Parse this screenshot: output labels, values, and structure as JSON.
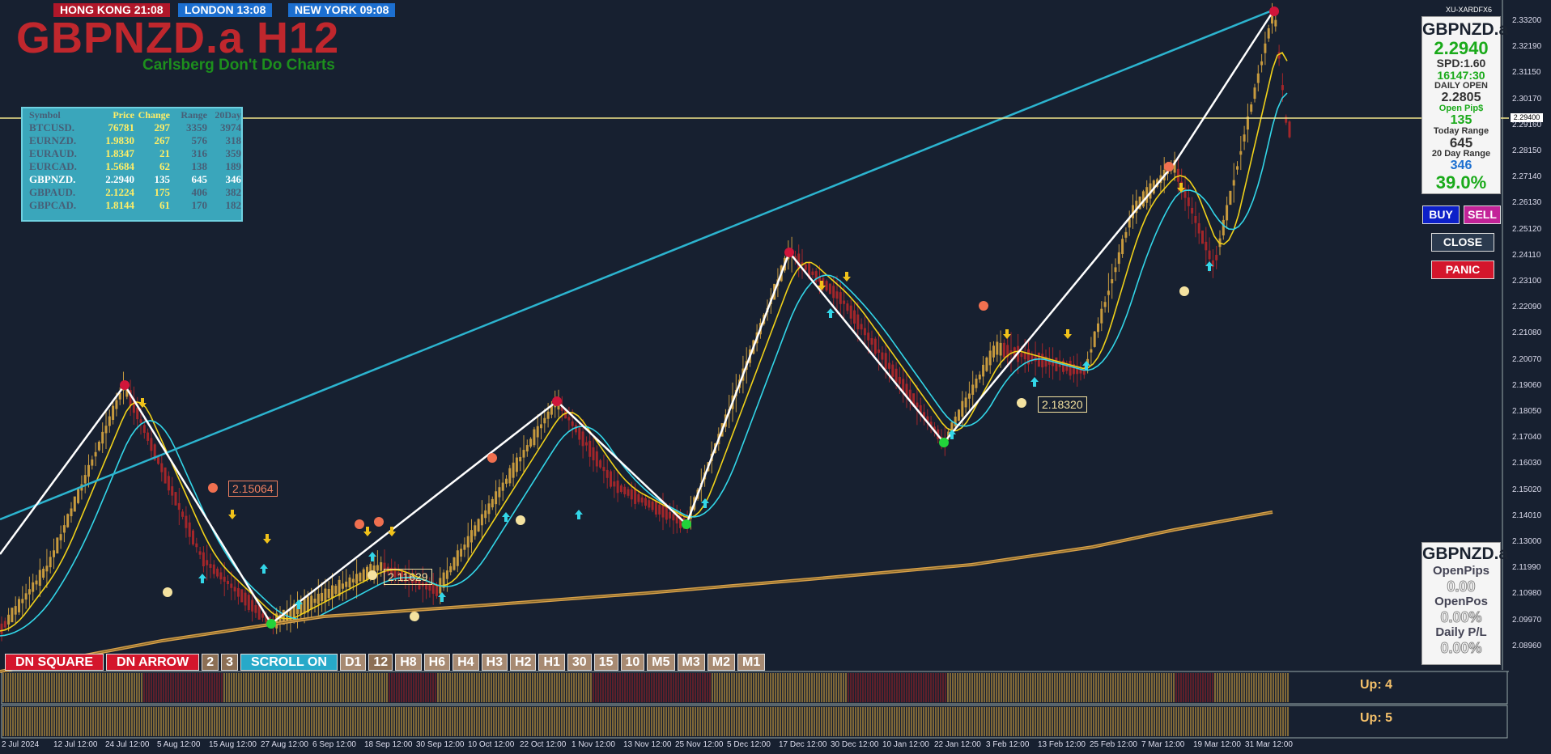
{
  "clocks": {
    "hong_kong": "HONG KONG 21:08",
    "london": "LONDON  13:08",
    "new_york": "NEW YORK  09:08"
  },
  "title": "GBPNZD.a H12",
  "subtitle": "Carlsberg Don't Do Charts",
  "broker": "XU-XARDFX6",
  "market_watch": {
    "headers": [
      "Symbol",
      "Price",
      "Change",
      "Range",
      "20Day"
    ],
    "rows": [
      {
        "symbol": "BTCUSD.",
        "price": "76781",
        "change": "297",
        "range": "3359",
        "d20": "3974"
      },
      {
        "symbol": "EURNZD.",
        "price": "1.9830",
        "change": "267",
        "range": "576",
        "d20": "318"
      },
      {
        "symbol": "EURAUD.",
        "price": "1.8347",
        "change": "21",
        "range": "316",
        "d20": "359"
      },
      {
        "symbol": "EURCAD.",
        "price": "1.5684",
        "change": "62",
        "range": "138",
        "d20": "189"
      },
      {
        "symbol": "GBPNZD.",
        "price": "2.2940",
        "change": "135",
        "range": "645",
        "d20": "346"
      },
      {
        "symbol": "GBPAUD.",
        "price": "2.1224",
        "change": "175",
        "range": "406",
        "d20": "382"
      },
      {
        "symbol": "GBPCAD.",
        "price": "1.8144",
        "change": "61",
        "range": "170",
        "d20": "182"
      }
    ]
  },
  "info_panel": {
    "symbol": "GBPNZD.a",
    "price": "2.2940",
    "spread": "SPD:1.60",
    "timer": "16147:30",
    "daily_open_label": "DAILY OPEN",
    "daily_open": "2.2805",
    "open_pips_label": "Open Pip$",
    "open_pips": "135",
    "today_range_label": "Today Range",
    "today_range": "645",
    "day20_label": "20 Day Range",
    "day20": "346",
    "percent": "39.0%"
  },
  "buttons": {
    "buy": "BUY",
    "sell": "SELL",
    "close": "CLOSE",
    "panic": "PANIC"
  },
  "pl_panel": {
    "symbol": "GBPNZD.a",
    "open_pips_label": "OpenPips",
    "open_pips": "0.00",
    "open_pos_label": "OpenPos",
    "open_pos": "0.00%",
    "daily_pl_label": "Daily P/L",
    "daily_pl": "0.00%"
  },
  "timeframe_bar": [
    "DN SQUARE",
    "DN ARROW",
    "2",
    "3",
    "SCROLL ON",
    "D1",
    "12",
    "H8",
    "H6",
    "H4",
    "H3",
    "H2",
    "H1",
    "30",
    "15",
    "10",
    "M5",
    "M3",
    "M2",
    "M1"
  ],
  "sub_panels": {
    "up1": "Up: 4",
    "up2": "Up: 5"
  },
  "price_axis": [
    "2.33200",
    "2.32190",
    "2.31150",
    "2.30170",
    "2.29160",
    "2.28150",
    "2.27140",
    "2.26130",
    "2.25120",
    "2.24110",
    "2.23100",
    "2.22090",
    "2.21080",
    "2.20070",
    "2.19060",
    "2.18050",
    "2.17040",
    "2.16030",
    "2.15020",
    "2.14010",
    "2.13000",
    "2.11990",
    "2.10980",
    "2.09970",
    "2.08960"
  ],
  "current_price_tag": "2.29400",
  "price_labels": {
    "a": "2.15064",
    "b": "2.11629",
    "c": "2.18320"
  },
  "time_axis": [
    "2 Jul 2024",
    "12 Jul 12:00",
    "24 Jul 12:00",
    "5 Aug 12:00",
    "15 Aug 12:00",
    "27 Aug 12:00",
    "6 Sep 12:00",
    "18 Sep 12:00",
    "30 Sep 12:00",
    "10 Oct 12:00",
    "22 Oct 12:00",
    "1 Nov 12:00",
    "13 Nov 12:00",
    "25 Nov 12:00",
    "5 Dec 12:00",
    "17 Dec 12:00",
    "30 Dec 12:00",
    "10 Jan 12:00",
    "22 Jan 12:00",
    "3 Feb 12:00",
    "13 Feb 12:00",
    "25 Feb 12:00",
    "7 Mar 12:00",
    "19 Mar 12:00",
    "31 Mar 12:00"
  ],
  "colors": {
    "background": "#172030",
    "zigzag": "#ffffff",
    "trendline": "#2cb4cf",
    "ma_fast": "#33d6e8",
    "ma_slow": "#f1d21a",
    "ma_long": "#d7a04a",
    "bull": "#c79a3e",
    "bear": "#a3262a"
  }
}
